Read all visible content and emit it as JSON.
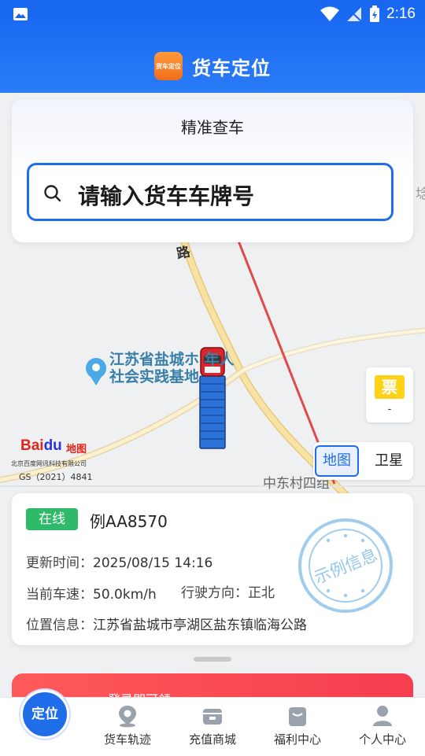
{
  "status_bar": {
    "time": "2:16"
  },
  "header": {
    "logo_text": "货车定位",
    "title": "货车定位"
  },
  "search": {
    "card_title": "精准查车",
    "placeholder": "请输入货车车牌号"
  },
  "map": {
    "poi_line1": "江苏省盐城ホ 年人",
    "poi_line2": "社会实践基地",
    "road_label": "路",
    "village_label": "中东村四组",
    "edge_label": "埝",
    "baidu": {
      "brand": "Bai",
      "brand_du": "du",
      "ditu": "地图",
      "company": "北京百度网讯科技有限公司",
      "gs": "GS（2021）4841"
    }
  },
  "ticket": {
    "icon_text": "票",
    "value": "-"
  },
  "layer_toggle": {
    "map_label": "地图",
    "satellite_label": "卫星",
    "selected": "地图"
  },
  "vehicle": {
    "status": "在线",
    "plate": "例AA8570",
    "update_time_label": "更新时间：",
    "update_time": "2025/08/15 14:16",
    "speed_label": "当前车速：",
    "speed": "50.0km/h",
    "direction_label": "行驶方向：",
    "direction": "正北",
    "location_label": "位置信息：",
    "location": "江苏省盐城市亭湖区盐东镇临海公路",
    "stamp_text": "示例信息"
  },
  "promo": {
    "text": "登录即可领"
  },
  "nav": {
    "items": [
      {
        "label": "定位",
        "icon": "locate-icon",
        "active": true
      },
      {
        "label": "货车轨迹",
        "icon": "track-icon"
      },
      {
        "label": "充值商城",
        "icon": "shop-icon"
      },
      {
        "label": "福利中心",
        "icon": "gift-icon"
      },
      {
        "label": "个人中心",
        "icon": "user-icon"
      }
    ]
  },
  "colors": {
    "primary": "#1f6de8",
    "online_green": "#2fba6a",
    "promo_red": "#f53d4f",
    "road_yellow": "#f7d98a"
  }
}
